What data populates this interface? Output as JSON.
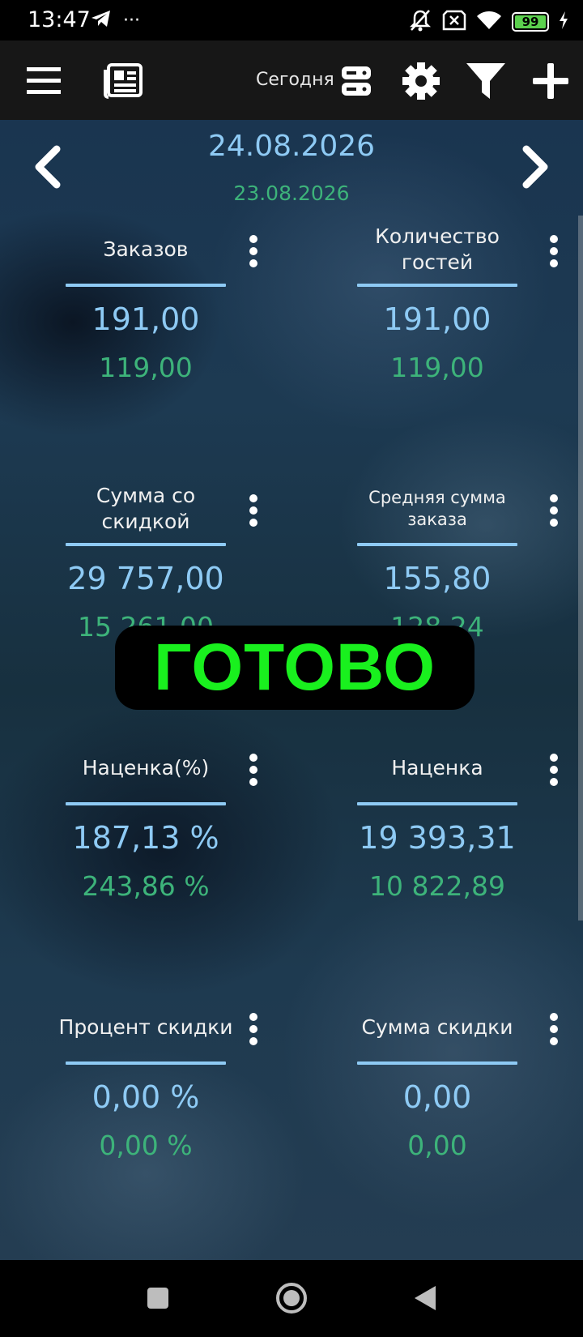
{
  "status_bar": {
    "time": "13:47",
    "more": "···",
    "battery": "99",
    "icons": [
      "telegram-icon",
      "more-dots-icon",
      "mute-icon",
      "no-sim-icon",
      "wifi-icon",
      "battery-icon",
      "charging-icon"
    ]
  },
  "toolbar": {
    "today_label": "Сегодня",
    "icons": [
      "menu-icon",
      "report-icon",
      "server-icon",
      "gear-icon",
      "filter-icon",
      "plus-icon"
    ]
  },
  "date": {
    "current": "24.08.2026",
    "previous": "23.08.2026"
  },
  "tiles": [
    {
      "title": "Заказов",
      "value": "191,00",
      "prev": "119,00"
    },
    {
      "title": "Количество гостей",
      "value": "191,00",
      "prev": "119,00"
    },
    {
      "title": "Сумма со скидкой",
      "value": "29 757,00",
      "prev": "15 261,00"
    },
    {
      "title": "Средняя сумма заказа",
      "value": "155,80",
      "prev": "128,24"
    },
    {
      "title": "Наценка(%)",
      "value": "187,13 %",
      "prev": "243,86 %"
    },
    {
      "title": "Наценка",
      "value": "19 393,31",
      "prev": "10 822,89"
    },
    {
      "title": "Процент скидки",
      "value": "0,00 %",
      "prev": "0,00 %"
    },
    {
      "title": "Сумма скидки",
      "value": "0,00",
      "prev": "0,00"
    }
  ],
  "toast": {
    "text": "ГОТОВО"
  },
  "colors": {
    "accent_blue": "#8ecaf4",
    "accent_green": "#3db37a",
    "toast_green": "#19f01e"
  }
}
